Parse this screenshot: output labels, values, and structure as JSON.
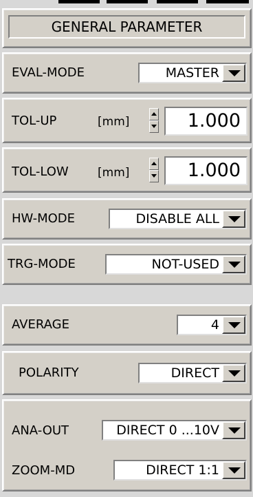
{
  "header": {
    "title": "GENERAL PARAMETER"
  },
  "eval_mode": {
    "label": "EVAL-MODE",
    "value": "MASTER"
  },
  "tol_up": {
    "label": "TOL-UP",
    "unit": "[mm]",
    "value": "1.000"
  },
  "tol_low": {
    "label": "TOL-LOW",
    "unit": "[mm]",
    "value": "1.000"
  },
  "hw_mode": {
    "label": "HW-MODE",
    "value": "DISABLE ALL"
  },
  "trg_mode": {
    "label": "TRG-MODE",
    "value": "NOT-USED"
  },
  "average": {
    "label": "AVERAGE",
    "value": "4"
  },
  "polarity": {
    "label": "POLARITY",
    "value": "DIRECT"
  },
  "ana_out": {
    "label": "ANA-OUT",
    "value": "DIRECT 0 ...10V"
  },
  "zoom_md": {
    "label": "ZOOM-MD",
    "value": "DIRECT 1:1"
  },
  "icons": [
    "dropdown-arrow-icon",
    "spin-up-icon",
    "spin-down-icon"
  ],
  "colors": {
    "background": "#d4d0c8",
    "field": "#ffffff",
    "text": "#000000"
  }
}
